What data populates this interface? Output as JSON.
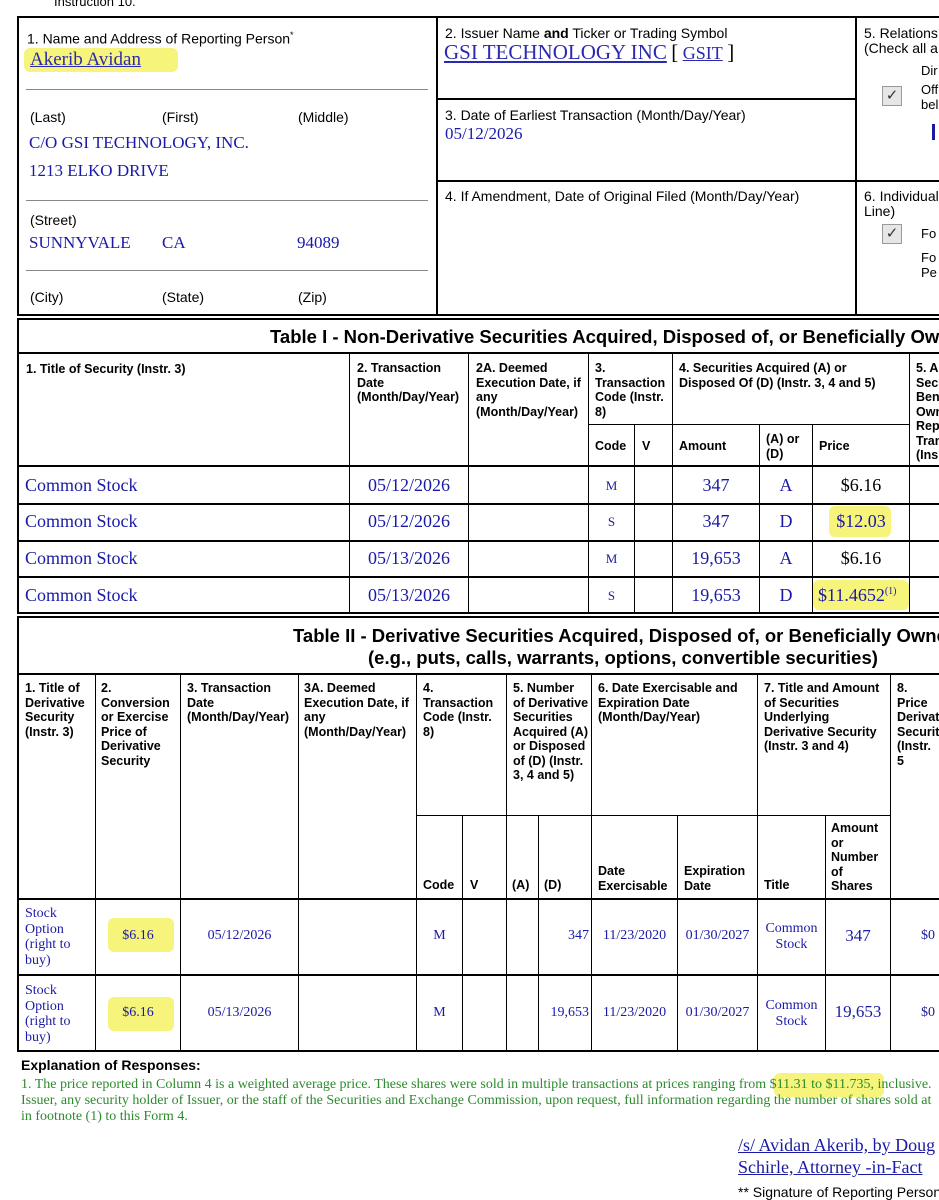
{
  "top_instruction": "Instruction 10.",
  "box1": {
    "label": "1. Name and Address of Reporting Person",
    "asterisk": "*",
    "name": "Akerib Avidan",
    "last_label": "(Last)",
    "first_label": "(First)",
    "middle_label": "(Middle)",
    "address1": "C/O GSI TECHNOLOGY, INC.",
    "address2": "1213 ELKO DRIVE",
    "street_label": "(Street)",
    "city": "SUNNYVALE",
    "state": "CA",
    "zip": "94089",
    "city_label": "(City)",
    "state_label": "(State)",
    "zip_label": "(Zip)"
  },
  "box2": {
    "label_pre": "2. Issuer Name ",
    "label_and": "and",
    "label_post": " Ticker or Trading Symbol",
    "issuer": "GSI TECHNOLOGY INC",
    "bracket_open": "[",
    "ticker": "GSIT",
    "bracket_close": "]"
  },
  "box3": {
    "label": "3. Date of Earliest Transaction (Month/Day/Year)",
    "value": "05/12/2026"
  },
  "box4": {
    "label": "4. If Amendment, Date of Original Filed (Month/Day/Year)"
  },
  "box5": {
    "label1": "5. Relations",
    "label2": "(Check all a",
    "opt1": "Dir",
    "opt2a": "Off",
    "opt2b": "bel",
    "check_mark": "✓"
  },
  "box6": {
    "label1": "6. Individual",
    "label2": "Line)",
    "opt1": "Fo",
    "opt2a": "Fo",
    "opt2b": "Pe",
    "check_mark": "✓"
  },
  "table1": {
    "title": "Table I - Non-Derivative Securities Acquired, Disposed of, or Beneficially Owr",
    "headers": {
      "c1": "1. Title of Security (Instr. 3)",
      "c2": "2. Transaction Date (Month/Day/Year)",
      "c2a": "2A. Deemed Execution Date, if any (Month/Day/Year)",
      "c3": "3. Transaction Code (Instr. 8)",
      "c4": "4. Securities Acquired (A) or Disposed Of (D) (Instr. 3, 4 and 5)",
      "c5": "5. A Sec Ben Own Rep Tran (Ins",
      "code": "Code",
      "v": "V",
      "amount": "Amount",
      "ad": "(A) or (D)",
      "price": "Price"
    },
    "rows": [
      {
        "title": "Common Stock",
        "date": "05/12/2026",
        "code": "M",
        "amount": "347",
        "ad": "A",
        "price": "$6.16",
        "fn": ""
      },
      {
        "title": "Common Stock",
        "date": "05/12/2026",
        "code": "S",
        "amount": "347",
        "ad": "D",
        "price": "$12.03",
        "fn": ""
      },
      {
        "title": "Common Stock",
        "date": "05/13/2026",
        "code": "M",
        "amount": "19,653",
        "ad": "A",
        "price": "$6.16",
        "fn": ""
      },
      {
        "title": "Common Stock",
        "date": "05/13/2026",
        "code": "S",
        "amount": "19,653",
        "ad": "D",
        "price": "$11.4652",
        "fn": "(1)"
      }
    ]
  },
  "table2": {
    "title1": "Table II - Derivative Securities Acquired, Disposed of, or Beneficially Owne",
    "title2": "(e.g., puts, calls, warrants, options, convertible securities)",
    "headers": {
      "c1": "1. Title of Derivative Security (Instr. 3)",
      "c2": "2. Conversion or Exercise Price of Derivative Security",
      "c3": "3. Transaction Date (Month/Day/Year)",
      "c3a": "3A. Deemed Execution Date, if any (Month/Day/Year)",
      "c4": "4. Transaction Code (Instr. 8)",
      "c5": "5. Number of Derivative Securities Acquired (A) or Disposed of (D) (Instr. 3, 4 and 5)",
      "c6": "6. Date Exercisable and Expiration Date (Month/Day/Year)",
      "c7": "7. Title and Amount of Securities Underlying Derivative Security (Instr. 3 and 4)",
      "c8": "8. Price Derivat Securit (Instr. 5",
      "code": "Code",
      "v": "V",
      "a": "(A)",
      "d": "(D)",
      "date_ex": "Date Exercisable",
      "exp": "Expiration Date",
      "title": "Title",
      "amount": "Amount or Number of Shares"
    },
    "rows": [
      {
        "title": "Stock Option (right to buy)",
        "price": "$6.16",
        "date": "05/12/2026",
        "code": "M",
        "d": "347",
        "exercisable": "11/23/2020",
        "expiration": "01/30/2027",
        "under_title": "Common Stock",
        "shares": "347",
        "deriv_price": "$0"
      },
      {
        "title": "Stock Option (right to buy)",
        "price": "$6.16",
        "date": "05/13/2026",
        "code": "M",
        "d": "19,653",
        "exercisable": "11/23/2020",
        "expiration": "01/30/2027",
        "under_title": "Common Stock",
        "shares": "19,653",
        "deriv_price": "$0"
      }
    ]
  },
  "explanation": {
    "heading": "Explanation of Responses:",
    "line1_pre": "1. The price reported in Column 4 is a weighted average price. These shares were sold in multiple transactions at prices ranging from ",
    "line1_range": "$11.31 to $11.735",
    "line1_post": ", inclusive.",
    "line2": "Issuer, any security holder of Issuer, or the staff of the Securities and Exchange Commission, upon request, full information regarding the number of shares sold at",
    "line3": "in footnote (1) to this Form 4."
  },
  "signature": {
    "line1": "/s/ Avidan Akerib, by Doug",
    "line2": "Schirle, Attorney -in-Fact",
    "caption": "** Signature of Reporting Person"
  }
}
